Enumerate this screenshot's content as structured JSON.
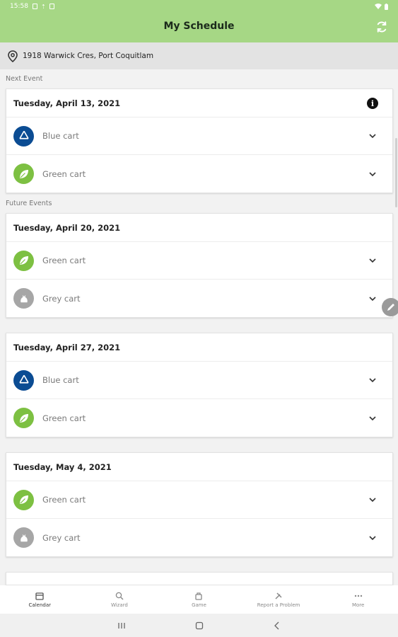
{
  "statusbar": {
    "time": "15:58"
  },
  "header": {
    "title": "My Schedule"
  },
  "address": {
    "text": "1918 Warwick Cres, Port Coquitlam"
  },
  "sections": {
    "next": "Next Event",
    "future": "Future Events"
  },
  "events": [
    {
      "date": "Tuesday, April 13, 2021",
      "items": [
        {
          "label": "Blue cart",
          "type": "blue"
        },
        {
          "label": "Green cart",
          "type": "green"
        }
      ]
    },
    {
      "date": "Tuesday, April 20, 2021",
      "items": [
        {
          "label": "Green cart",
          "type": "green"
        },
        {
          "label": "Grey cart",
          "type": "grey"
        }
      ]
    },
    {
      "date": "Tuesday, April 27, 2021",
      "items": [
        {
          "label": "Blue cart",
          "type": "blue"
        },
        {
          "label": "Green cart",
          "type": "green"
        }
      ]
    },
    {
      "date": "Tuesday, May 4, 2021",
      "items": [
        {
          "label": "Green cart",
          "type": "green"
        },
        {
          "label": "Grey cart",
          "type": "grey"
        }
      ]
    }
  ],
  "bottom_nav": [
    {
      "label": "Calendar",
      "icon": "calendar-icon"
    },
    {
      "label": "Wizard",
      "icon": "search-icon"
    },
    {
      "label": "Game",
      "icon": "game-icon"
    },
    {
      "label": "Report a Problem",
      "icon": "tools-icon"
    },
    {
      "label": "More",
      "icon": "more-icon"
    }
  ],
  "colors": {
    "header": "#a6d785",
    "blue_cart": "#0b4c93",
    "green_cart": "#7dc042",
    "grey_cart": "#a6a6a6"
  }
}
